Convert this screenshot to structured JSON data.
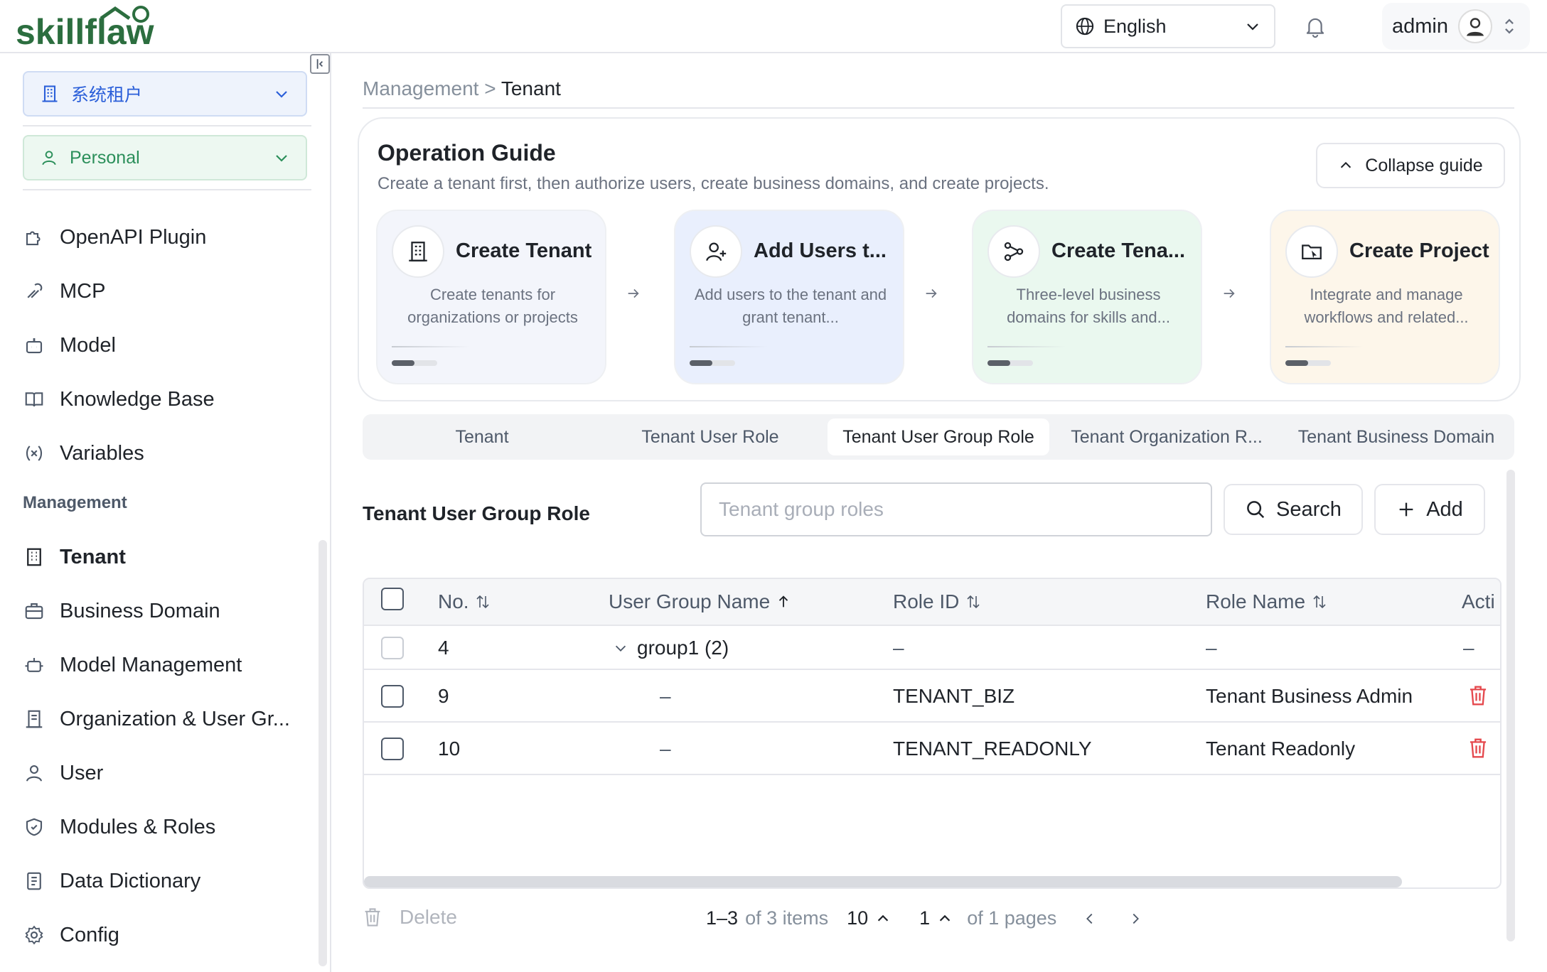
{
  "header": {
    "logo_text": "skillflaw",
    "language": "English",
    "user_name": "admin"
  },
  "sidebar": {
    "tenant_select": "系统租户",
    "space_select": "Personal",
    "items_top": [
      {
        "label": "OpenAPI Plugin",
        "icon": "puzzle-icon"
      },
      {
        "label": "MCP",
        "icon": "mcp-icon"
      },
      {
        "label": "Model",
        "icon": "robot-icon"
      },
      {
        "label": "Knowledge Base",
        "icon": "book-icon"
      },
      {
        "label": "Variables",
        "icon": "variable-icon"
      }
    ],
    "section_title": "Management",
    "items_mgmt": [
      {
        "label": "Tenant",
        "icon": "building-icon"
      },
      {
        "label": "Business Domain",
        "icon": "briefcase-icon"
      },
      {
        "label": "Model Management",
        "icon": "model-icon"
      },
      {
        "label": "Organization & User Gr...",
        "icon": "org-icon"
      },
      {
        "label": "User",
        "icon": "user-icon"
      },
      {
        "label": "Modules & Roles",
        "icon": "shield-icon"
      },
      {
        "label": "Data Dictionary",
        "icon": "dictionary-icon"
      },
      {
        "label": "Config",
        "icon": "gear-icon"
      }
    ]
  },
  "breadcrumb": {
    "parent": "Management",
    "separator": ">",
    "current": "Tenant"
  },
  "guide": {
    "title": "Operation Guide",
    "subtitle": "Create a tenant first, then authorize users, create business domains, and create projects.",
    "collapse_label": "Collapse guide",
    "cards": [
      {
        "title": "Create Tenant",
        "desc": "Create tenants for organizations or projects",
        "bg": "#f3f5fb"
      },
      {
        "title": "Add Users t...",
        "desc": "Add users to the tenant and grant tenant...",
        "bg": "#e9effd"
      },
      {
        "title": "Create Tena...",
        "desc": "Three-level business domains for skills and...",
        "bg": "#eaf8ef"
      },
      {
        "title": "Create Project",
        "desc": "Integrate and manage workflows and related...",
        "bg": "#fdf6ea"
      }
    ]
  },
  "tabs": [
    "Tenant",
    "Tenant User Role",
    "Tenant User Group Role",
    "Tenant Organization R...",
    "Tenant Business Domain"
  ],
  "section_title": "Tenant User Group Role",
  "search": {
    "placeholder": "Tenant group roles",
    "button": "Search",
    "add": "Add"
  },
  "table": {
    "headers": {
      "no": "No.",
      "group": "User Group Name",
      "role_id": "Role ID",
      "role_name": "Role Name",
      "action": "Acti"
    },
    "rows": [
      {
        "no": "4",
        "group": "group1 (2)",
        "role_id": "–",
        "role_name": "–",
        "action": "–"
      },
      {
        "no": "9",
        "group": "–",
        "role_id": "TENANT_BIZ",
        "role_name": "Tenant Business Admin"
      },
      {
        "no": "10",
        "group": "–",
        "role_id": "TENANT_READONLY",
        "role_name": "Tenant Readonly"
      }
    ]
  },
  "footer": {
    "delete": "Delete",
    "range": "1–3",
    "of_items": "of 3 items",
    "page_size": "10",
    "page": "1",
    "of_pages": "of 1 pages"
  },
  "colors": {
    "danger": "#e5484d",
    "accent_blue": "#2b5fd9",
    "accent_green": "#2b8f5a"
  }
}
